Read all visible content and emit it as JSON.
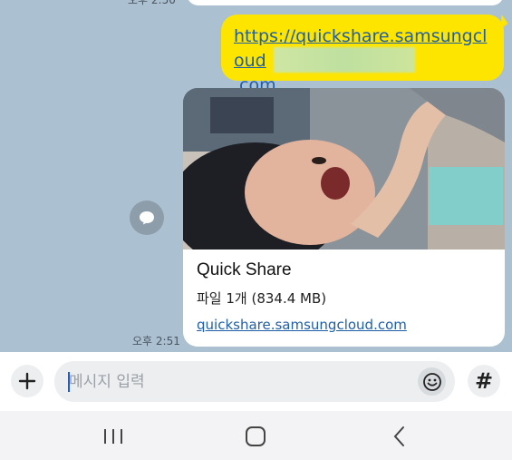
{
  "chat": {
    "top_time": "오후 2:50",
    "link_message": "https://quickshare.samsungcloud.com",
    "link_display_line1": "https://quickshare.samsungcloud",
    "link_display_line2": ".com",
    "card": {
      "title": "Quick Share",
      "subtitle": "파일 1개 (834.4 MB)",
      "link": "quickshare.samsungcloud.com"
    },
    "bottom_time": "오후 2:51"
  },
  "input": {
    "placeholder": "메시지 입력",
    "value": ""
  },
  "icons": {
    "plus": "plus-icon",
    "emoji": "emoji-icon",
    "hash": "hash-icon",
    "share": "share-bubble-icon",
    "nav_recent": "recent-apps-icon",
    "nav_home": "home-icon",
    "nav_back": "back-icon"
  },
  "labels": {
    "hash_symbol": "#"
  },
  "colors": {
    "chat_background": "#abc0d1",
    "my_bubble": "#fee500",
    "link": "#1f5fa8",
    "input_background": "#eceef0"
  }
}
